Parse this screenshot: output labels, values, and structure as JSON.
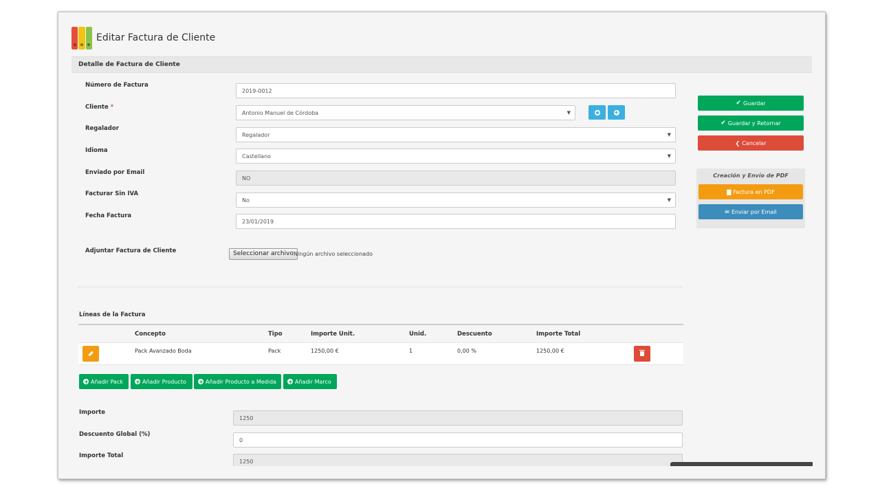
{
  "page": {
    "title": "Editar Factura de Cliente",
    "section_header": "Detalle de Factura de Cliente"
  },
  "form": {
    "numero_label": "Número de Factura",
    "numero_value": "2019-0012",
    "cliente_label": "Cliente",
    "cliente_required": "*",
    "cliente_value": "Antonio Manuel de Córdoba",
    "regalador_label": "Regalador",
    "regalador_value": "Regalador",
    "idioma_label": "Idioma",
    "idioma_value": "Castellano",
    "enviado_label": "Enviado por Email",
    "enviado_value": "NO",
    "sin_iva_label": "Facturar Sin IVA",
    "sin_iva_value": "No",
    "fecha_label": "Fecha Factura",
    "fecha_value": "23/01/2019",
    "adjuntar_label": "Adjuntar Factura de Cliente",
    "file_button": "Seleccionar archivo",
    "file_none": "Ningún archivo seleccionado"
  },
  "actions": {
    "guardar": "Guardar",
    "guardar_retornar": "Guardar y Retornar",
    "cancelar": "Cancelar",
    "pdf_panel_title": "Creación y Envío de PDF",
    "factura_pdf": "Factura en PDF",
    "enviar_email": "Enviar por Email"
  },
  "lines": {
    "title": "Líneas de la Factura",
    "headers": [
      "Concepto",
      "Tipo",
      "Importe Unit.",
      "Unid.",
      "Descuento",
      "Importe Total"
    ],
    "rows": [
      [
        "Pack Avanzado Boda",
        "Pack",
        "1250,00 €",
        "1",
        "0,00 %",
        "1250,00 €"
      ]
    ],
    "add_buttons": [
      "Añadir Pack",
      "Añadir Producto",
      "Añadir Producto a Medida",
      "Añadir Marco"
    ]
  },
  "totals": {
    "importe_label": "Importe",
    "importe_value": "1250",
    "descuento_label": "Descuento Global (%)",
    "descuento_value": "0",
    "total_label": "Importe Total",
    "total_value": "1250"
  },
  "colors": {
    "green": "#00a65a",
    "red": "#dd4b39",
    "orange": "#f39c12",
    "blue": "#3c8dbc",
    "light_blue": "#3bb0e0"
  },
  "icons": {
    "header": "binders-icon",
    "check": "check-icon",
    "back": "chevron-left-icon",
    "file": "file-icon",
    "mail": "envelope-icon",
    "edit": "pencil-icon",
    "delete": "trash-icon",
    "add": "plus-circle-icon",
    "view": "eye-icon"
  }
}
